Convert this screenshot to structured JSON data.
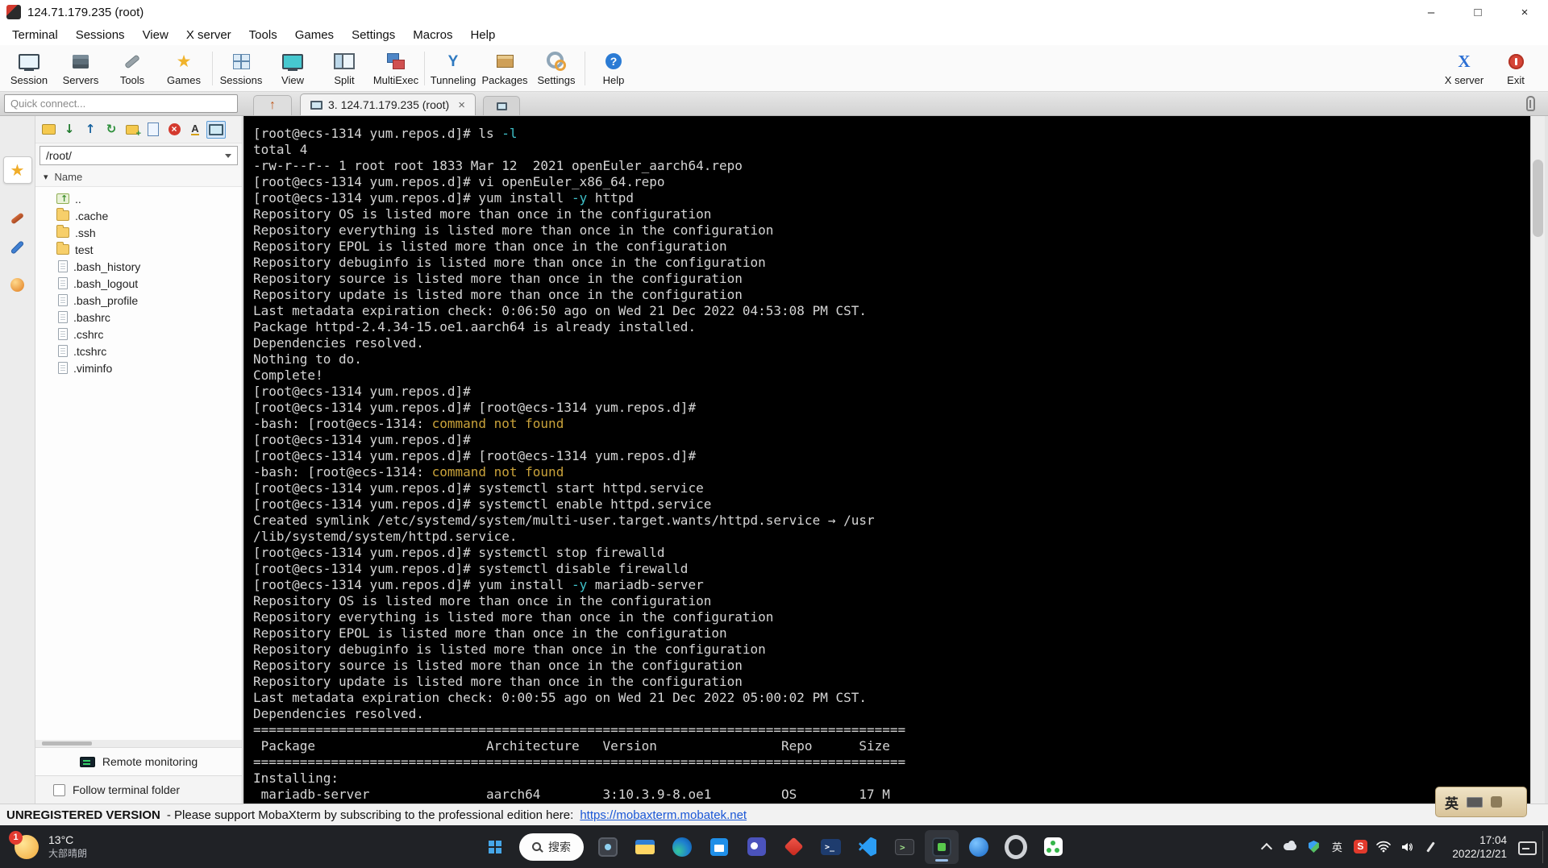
{
  "window": {
    "title": "124.71.179.235 (root)",
    "minimize_glyph": "–",
    "maximize_glyph": "□",
    "close_glyph": "×"
  },
  "menubar": {
    "items": [
      "Terminal",
      "Sessions",
      "View",
      "X server",
      "Tools",
      "Games",
      "Settings",
      "Macros",
      "Help"
    ]
  },
  "toolbar": {
    "buttons": [
      {
        "label": "Session",
        "icon": "session"
      },
      {
        "label": "Servers",
        "icon": "servers"
      },
      {
        "label": "Tools",
        "icon": "tools"
      },
      {
        "label": "Games",
        "icon": "games"
      },
      {
        "label": "Sessions",
        "icon": "sessions"
      },
      {
        "label": "View",
        "icon": "view"
      },
      {
        "label": "Split",
        "icon": "split"
      },
      {
        "label": "MultiExec",
        "icon": "multiexec"
      },
      {
        "label": "Tunneling",
        "icon": "tunneling"
      },
      {
        "label": "Packages",
        "icon": "packages"
      },
      {
        "label": "Settings",
        "icon": "settings"
      },
      {
        "label": "Help",
        "icon": "help"
      }
    ],
    "right_buttons": [
      {
        "label": "X server",
        "icon": "xserver"
      },
      {
        "label": "Exit",
        "icon": "exit"
      }
    ]
  },
  "tabbar": {
    "quick_connect_placeholder": "Quick connect...",
    "tabs": [
      {
        "label": "3. 124.71.179.235 (root)",
        "close_glyph": "×"
      }
    ]
  },
  "sidebar": {
    "side_tabs": [
      "sessions",
      "tools",
      "macros",
      "sftp"
    ],
    "toolbar_icons": [
      "sync-folder",
      "download",
      "upload",
      "refresh",
      "new-folder",
      "edit-file",
      "delete",
      "rename",
      "follow-terminal"
    ],
    "path": "/root/",
    "tree_arrow": "▾",
    "tree_header": "Name",
    "items": [
      {
        "label": "..",
        "type": "up"
      },
      {
        "label": ".cache",
        "type": "folder"
      },
      {
        "label": ".ssh",
        "type": "folder"
      },
      {
        "label": "test",
        "type": "folder"
      },
      {
        "label": ".bash_history",
        "type": "file"
      },
      {
        "label": ".bash_logout",
        "type": "file"
      },
      {
        "label": ".bash_profile",
        "type": "file"
      },
      {
        "label": ".bashrc",
        "type": "file"
      },
      {
        "label": ".cshrc",
        "type": "file"
      },
      {
        "label": ".tcshrc",
        "type": "file"
      },
      {
        "label": ".viminfo",
        "type": "file"
      }
    ],
    "remote_monitoring_label": "Remote monitoring",
    "follow_terminal_folder_label": "Follow terminal folder"
  },
  "terminal": {
    "lines": [
      [
        {
          "t": "[root@ecs-1314 yum.repos.d]# ls "
        },
        {
          "t": "-l",
          "c": "opt"
        }
      ],
      [
        {
          "t": "total 4"
        }
      ],
      [
        {
          "t": "-rw-r--r-- 1 root root 1833 Mar 12  2021 openEuler_aarch64.repo"
        }
      ],
      [
        {
          "t": "[root@ecs-1314 yum.repos.d]# vi openEuler_x86_64.repo"
        }
      ],
      [
        {
          "t": "[root@ecs-1314 yum.repos.d]# yum install "
        },
        {
          "t": "-y",
          "c": "opt"
        },
        {
          "t": " httpd"
        }
      ],
      [
        {
          "t": "Repository OS is listed more than once in the configuration"
        }
      ],
      [
        {
          "t": "Repository everything is listed more than once in the configuration"
        }
      ],
      [
        {
          "t": "Repository EPOL is listed more than once in the configuration"
        }
      ],
      [
        {
          "t": "Repository debuginfo is listed more than once in the configuration"
        }
      ],
      [
        {
          "t": "Repository source is listed more than once in the configuration"
        }
      ],
      [
        {
          "t": "Repository update is listed more than once in the configuration"
        }
      ],
      [
        {
          "t": "Last metadata expiration check: 0:06:50 ago on Wed 21 Dec 2022 04:53:08 PM CST."
        }
      ],
      [
        {
          "t": "Package httpd-2.4.34-15.oe1.aarch64 is already installed."
        }
      ],
      [
        {
          "t": "Dependencies resolved."
        }
      ],
      [
        {
          "t": "Nothing to do."
        }
      ],
      [
        {
          "t": "Complete!"
        }
      ],
      [
        {
          "t": "[root@ecs-1314 yum.repos.d]#"
        }
      ],
      [
        {
          "t": "[root@ecs-1314 yum.repos.d]# [root@ecs-1314 yum.repos.d]#"
        }
      ],
      [
        {
          "t": "-bash: [root@ecs-1314: "
        },
        {
          "t": "command not found",
          "c": "warn"
        }
      ],
      [
        {
          "t": "[root@ecs-1314 yum.repos.d]#"
        }
      ],
      [
        {
          "t": "[root@ecs-1314 yum.repos.d]# [root@ecs-1314 yum.repos.d]#"
        }
      ],
      [
        {
          "t": "-bash: [root@ecs-1314: "
        },
        {
          "t": "command not found",
          "c": "warn"
        }
      ],
      [
        {
          "t": "[root@ecs-1314 yum.repos.d]# systemctl start httpd.service"
        }
      ],
      [
        {
          "t": "[root@ecs-1314 yum.repos.d]# systemctl enable httpd.service"
        }
      ],
      [
        {
          "t": "Created symlink /etc/systemd/system/multi-user.target.wants/httpd.service → /usr"
        }
      ],
      [
        {
          "t": "/lib/systemd/system/httpd.service."
        }
      ],
      [
        {
          "t": "[root@ecs-1314 yum.repos.d]# systemctl stop firewalld"
        }
      ],
      [
        {
          "t": "[root@ecs-1314 yum.repos.d]# systemctl disable firewalld"
        }
      ],
      [
        {
          "t": "[root@ecs-1314 yum.repos.d]# yum install "
        },
        {
          "t": "-y",
          "c": "opt"
        },
        {
          "t": " mariadb-server"
        }
      ],
      [
        {
          "t": "Repository OS is listed more than once in the configuration"
        }
      ],
      [
        {
          "t": "Repository everything is listed more than once in the configuration"
        }
      ],
      [
        {
          "t": "Repository EPOL is listed more than once in the configuration"
        }
      ],
      [
        {
          "t": "Repository debuginfo is listed more than once in the configuration"
        }
      ],
      [
        {
          "t": "Repository source is listed more than once in the configuration"
        }
      ],
      [
        {
          "t": "Repository update is listed more than once in the configuration"
        }
      ],
      [
        {
          "t": "Last metadata expiration check: 0:00:55 ago on Wed 21 Dec 2022 05:00:02 PM CST."
        }
      ],
      [
        {
          "t": "Dependencies resolved."
        }
      ],
      [
        {
          "t": "===================================================================================="
        }
      ],
      [
        {
          "t": " Package                      Architecture   Version                Repo      Size"
        }
      ],
      [
        {
          "t": "===================================================================================="
        }
      ],
      [
        {
          "t": "Installing:"
        }
      ],
      [
        {
          "t": " mariadb-server               aarch64        3:10.3.9-8.oe1         OS        17 M"
        }
      ]
    ]
  },
  "statusbar": {
    "bold": "UNREGISTERED VERSION",
    "text": "-  Please support MobaXterm by subscribing to the professional edition here:",
    "link": "https://mobaxterm.mobatek.net"
  },
  "ime": {
    "mode_label": "英"
  },
  "taskbar": {
    "weather": {
      "badge": "1",
      "temp": "13°C",
      "desc": "大部晴朗"
    },
    "search_label": "搜索",
    "app_icons": [
      "photos",
      "file-explorer",
      "edge",
      "store",
      "teams",
      "red-diamond",
      "powershell",
      "vscode",
      "terminal",
      "mobaxterm",
      "blue-circle",
      "settings",
      "green-app"
    ],
    "active_app": "mobaxterm",
    "tray_icons": [
      "chevron-up",
      "cloud",
      "security-shield",
      "ime-mode",
      "sogou",
      "wifi",
      "volume",
      "pen"
    ],
    "ime_mode": "英",
    "clock": {
      "time": "17:04",
      "date": "2022/12/21"
    }
  }
}
